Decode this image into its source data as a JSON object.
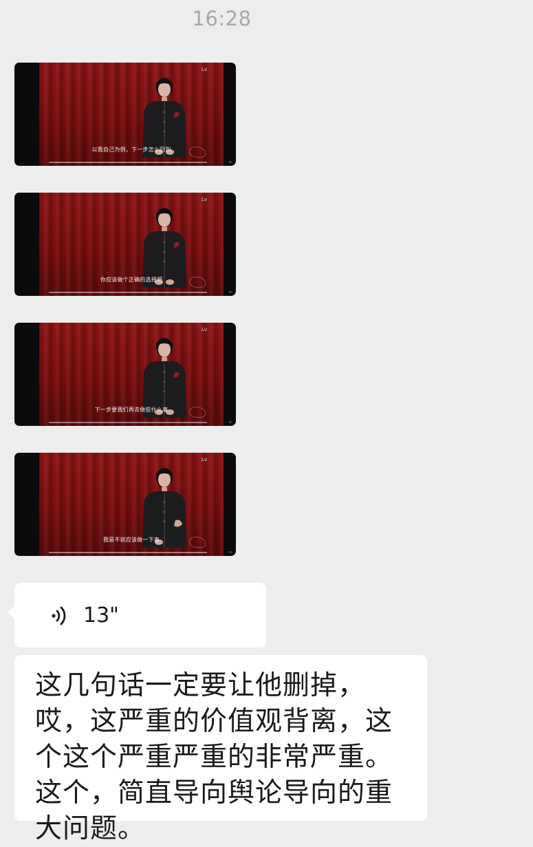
{
  "chat": {
    "timestamp": "16:28",
    "video_messages": [
      {
        "caption": "以我自己为例，下一步怎么回到",
        "brand": "Lv"
      },
      {
        "caption": "你应该做个正确的选择吧",
        "brand": "Lv"
      },
      {
        "caption": "下一步要我们再去做些什么事",
        "brand": "Lv"
      },
      {
        "caption": "我是不就应该做一下事",
        "brand": "Lv"
      }
    ],
    "voice_message": {
      "icon": "voice-wave-icon",
      "duration": "13\""
    },
    "text_message": "这几句话一定要让他删掉，哎，这严重的价值观背离，这个这个严重严重的非常严重。这个，简直导向舆论导向的重大问题。"
  },
  "colors": {
    "background": "#ededed",
    "bubble": "#ffffff",
    "timestamp": "#a7a7a7",
    "curtain_red": "#8e1414"
  }
}
